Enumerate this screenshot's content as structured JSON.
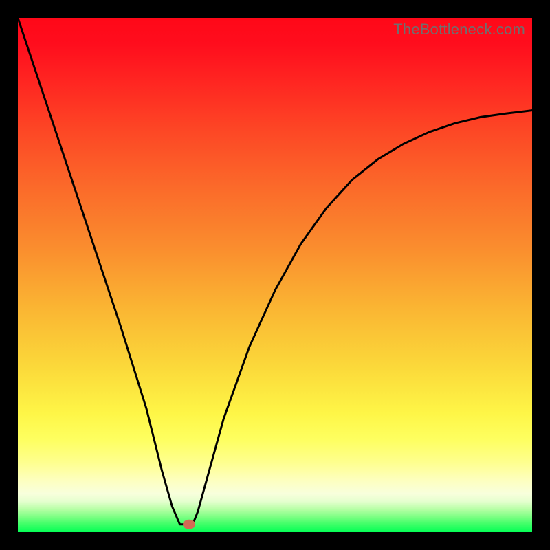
{
  "attribution": "TheBottleneck.com",
  "chart_data": {
    "type": "line",
    "title": "",
    "xlabel": "",
    "ylabel": "",
    "xlim": [
      0,
      100
    ],
    "ylim": [
      0,
      100
    ],
    "grid": false,
    "legend": false,
    "series": [
      {
        "name": "curve",
        "x": [
          0,
          5,
          10,
          15,
          20,
          25,
          28,
          30,
          31.5,
          33,
          34,
          35,
          40,
          45,
          50,
          55,
          60,
          65,
          70,
          75,
          80,
          85,
          90,
          95,
          100
        ],
        "values": [
          100,
          85,
          70,
          55,
          40,
          24,
          12,
          5,
          1.5,
          1.5,
          1.5,
          4,
          22,
          36,
          47,
          56,
          63,
          68.5,
          72.5,
          75.5,
          77.8,
          79.5,
          80.7,
          81.4,
          82
        ]
      }
    ],
    "marker": {
      "x": 33.3,
      "y": 1.5,
      "color": "#d36a54"
    },
    "colors": {
      "curve": "#000000",
      "frame": "#000000",
      "marker_fill": "#d36a54"
    }
  }
}
